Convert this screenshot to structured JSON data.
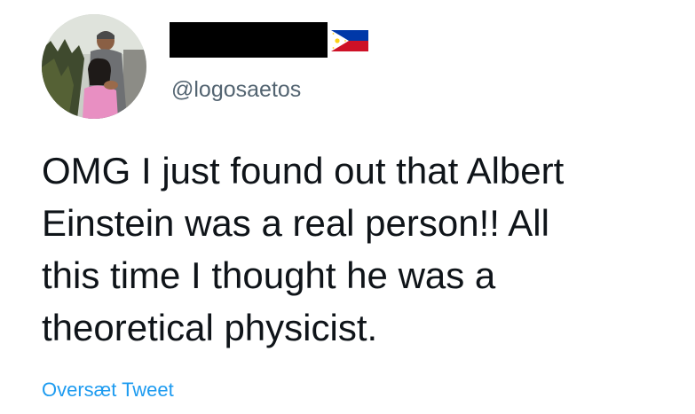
{
  "tweet": {
    "author": {
      "handle": "@logosaetos",
      "flag_icon": "philippines-flag-icon",
      "avatar_icon": "profile-photo"
    },
    "text": "OMG I just found out that Albert\nEinstein was a real person!! All\nthis time I thought he was a\ntheoretical physicist.",
    "translate_label": "Oversæt Tweet"
  },
  "colors": {
    "text": "#0f1419",
    "secondary": "#536471",
    "link": "#1d9bf0",
    "background": "#ffffff",
    "redaction": "#000000"
  }
}
